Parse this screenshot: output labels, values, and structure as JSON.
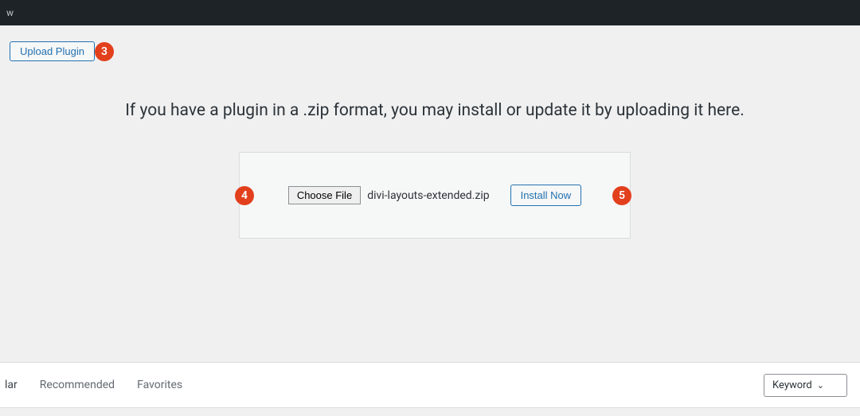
{
  "topbar": {
    "crumb": "w"
  },
  "header": {
    "upload_button": "Upload Plugin",
    "badge3": "3"
  },
  "upload": {
    "instruction": "If you have a plugin in a .zip format, you may install or update it by uploading it here.",
    "choose_file": "Choose File",
    "file_name": "divi-layouts-extended.zip",
    "install_now": "Install Now",
    "badge4": "4",
    "badge5": "5"
  },
  "tabs": {
    "partial_first": "lar",
    "recommended": "Recommended",
    "favorites": "Favorites"
  },
  "filter": {
    "keyword": "Keyword"
  }
}
